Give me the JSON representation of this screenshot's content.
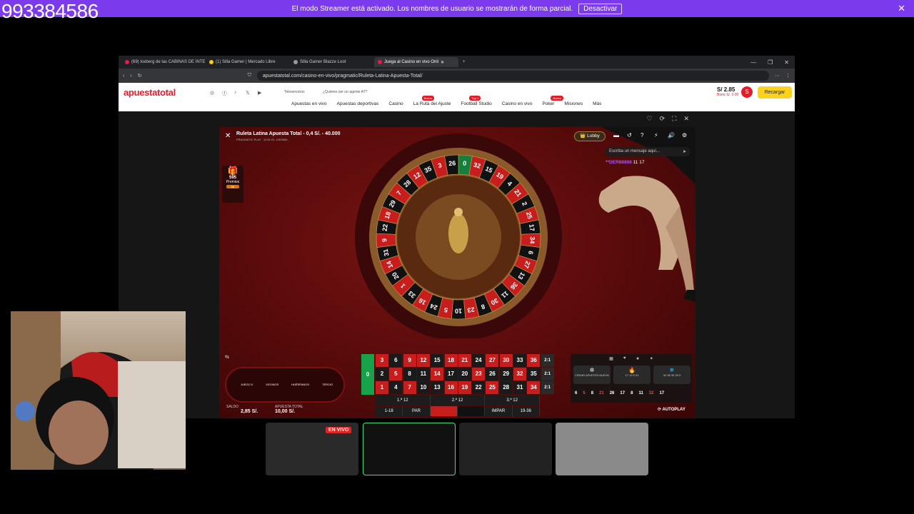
{
  "stream": {
    "id_number": "993384586",
    "banner_text": "El modo Streamer está activado. Los nombres de usuario se mostrarán de forma parcial.",
    "banner_button": "Desactivar",
    "live_badge": "EN VIVO"
  },
  "browser": {
    "tabs": [
      {
        "label": "(69) Iceberg de las CABINAS DE INTE"
      },
      {
        "label": "(1) Silla Gamer | Mercado Libre"
      },
      {
        "label": "Silla Gamer Blazze Loot"
      },
      {
        "label": "Juega al Casino en vivo Onli"
      }
    ],
    "url": "apuestatotal.com/casino-en-vivo/pragmatic/Ruleta-Latina-Apuesta-Total/"
  },
  "site": {
    "logo_a": "apuesta",
    "logo_b": "total",
    "teleservicios": "Teleservicios",
    "agent_link": "¿Quieres ser un agente AT?",
    "nav": [
      {
        "label": "Apuestas en vivo",
        "tag": ""
      },
      {
        "label": "Apuestas deportivas",
        "tag": ""
      },
      {
        "label": "Casino",
        "tag": ""
      },
      {
        "label": "La Ruta del Ajuste",
        "tag": "Nuevo"
      },
      {
        "label": "Football Studio",
        "tag": "Top 1"
      },
      {
        "label": "Casino en vivo",
        "tag": ""
      },
      {
        "label": "Poker",
        "tag": "Nuevo"
      },
      {
        "label": "Misiones",
        "tag": ""
      },
      {
        "label": "Más",
        "tag": ""
      }
    ],
    "balance": "S/ 2.85",
    "bonus": "Bono S/. 0.00",
    "avatar_letter": "S",
    "recharge": "Recargar"
  },
  "game": {
    "title": "Ruleta Latina Apuesta Total - 0,4 S/. - 40.000",
    "subtitle": "PRAGMATIC PLAY · 10:01 ID: 1267865...",
    "prizes_count": "595",
    "prizes_label": "Premios",
    "prizes_pill": "5d",
    "lobby": "Lobby",
    "chat_placeholder": "Escriba un mensaje aquí...",
    "chat_user": "**DER88888",
    "chat_text": "11 17",
    "racetrack_labels": [
      "JUEGO 0",
      "VECINOS",
      "HUÉRFANOS",
      "TERCIO"
    ],
    "dozens": [
      "1.ª 12",
      "2.ª 12",
      "3.ª 12"
    ],
    "outside": [
      "1-18",
      "PAR",
      "",
      "",
      "IMPAR",
      "19-36"
    ],
    "saldo_label": "SALDO",
    "saldo_value": "2,85 S/.",
    "apuesta_label": "APUESTA TOTAL",
    "apuesta_value": "10,00 S/.",
    "special_bets": [
      {
        "label": "CREAR APUESTA NUEVA"
      },
      {
        "label": "17  13  5  31"
      },
      {
        "label": "34  36  30  29  0"
      }
    ],
    "last_numbers": [
      "6",
      "5",
      "8",
      "21",
      "26",
      "17",
      "8",
      "11",
      "32",
      "17"
    ],
    "autoplay": "AUTOPLAY",
    "wheel_numbers": [
      "0",
      "32",
      "15",
      "19",
      "4",
      "21",
      "2",
      "25",
      "17",
      "34",
      "6",
      "27",
      "13",
      "36",
      "11",
      "30",
      "8",
      "23",
      "10",
      "5",
      "24",
      "16",
      "33",
      "1",
      "20",
      "14",
      "31",
      "9",
      "22",
      "18",
      "29",
      "7",
      "28",
      "12",
      "35",
      "3",
      "26"
    ]
  },
  "colors": {
    "banner": "#7c3aed",
    "brand_red": "#e11d2a",
    "recharge": "#fdd21f",
    "green_zero": "#16a34a"
  }
}
